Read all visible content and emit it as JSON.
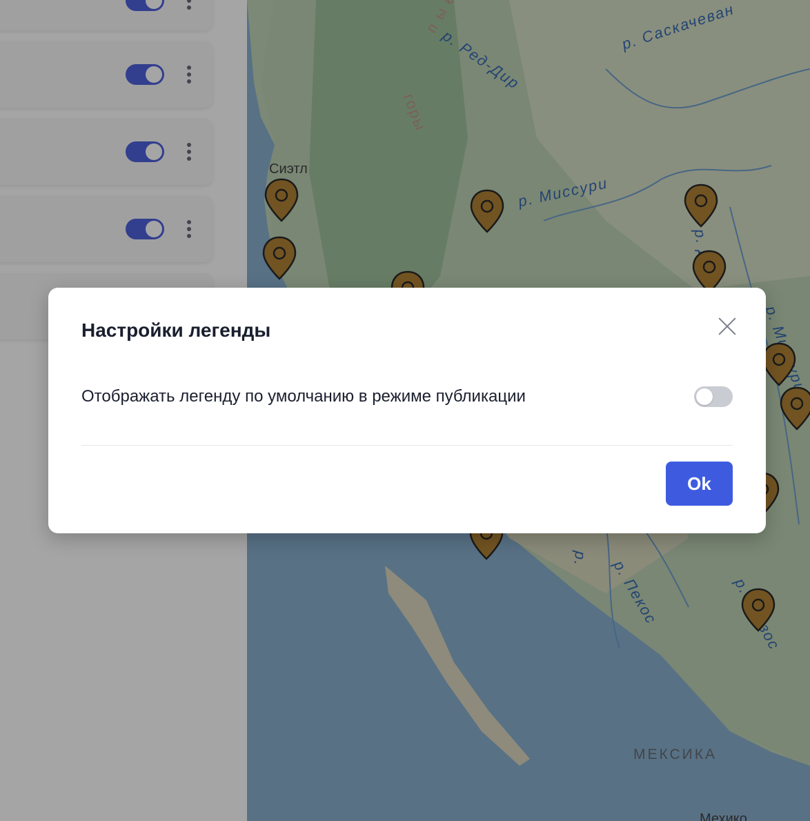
{
  "sidebar": {
    "layers": [
      {
        "enabled": true
      },
      {
        "enabled": true
      },
      {
        "enabled": true
      },
      {
        "enabled": true
      }
    ]
  },
  "map": {
    "labels": {
      "mountains": "горы",
      "mountains_prefix": "п ы е",
      "red_deer": "р. Ред-Дир",
      "saskatchewan": "р. Саскачеван",
      "missouri": "р. Миссури",
      "james": "р. Джеймс",
      "missouri2": "р. Миссури",
      "seattle": "Сиэтл",
      "pecos": "р. Пекос",
      "rio": "р.",
      "brazos": "р. Бразос",
      "mexico_country": "МЕКСИКА",
      "mexico_city": "Мехико"
    },
    "marker_color": "#a8741e"
  },
  "modal": {
    "title": "Настройки легенды",
    "setting_label": "Отображать легенду по умолчанию в режиме публикации",
    "setting_enabled": false,
    "ok_label": "Ok"
  },
  "colors": {
    "accent": "#3e5be0",
    "toggle_on": "#3a4fd7",
    "toggle_off": "#c9ccd2"
  }
}
